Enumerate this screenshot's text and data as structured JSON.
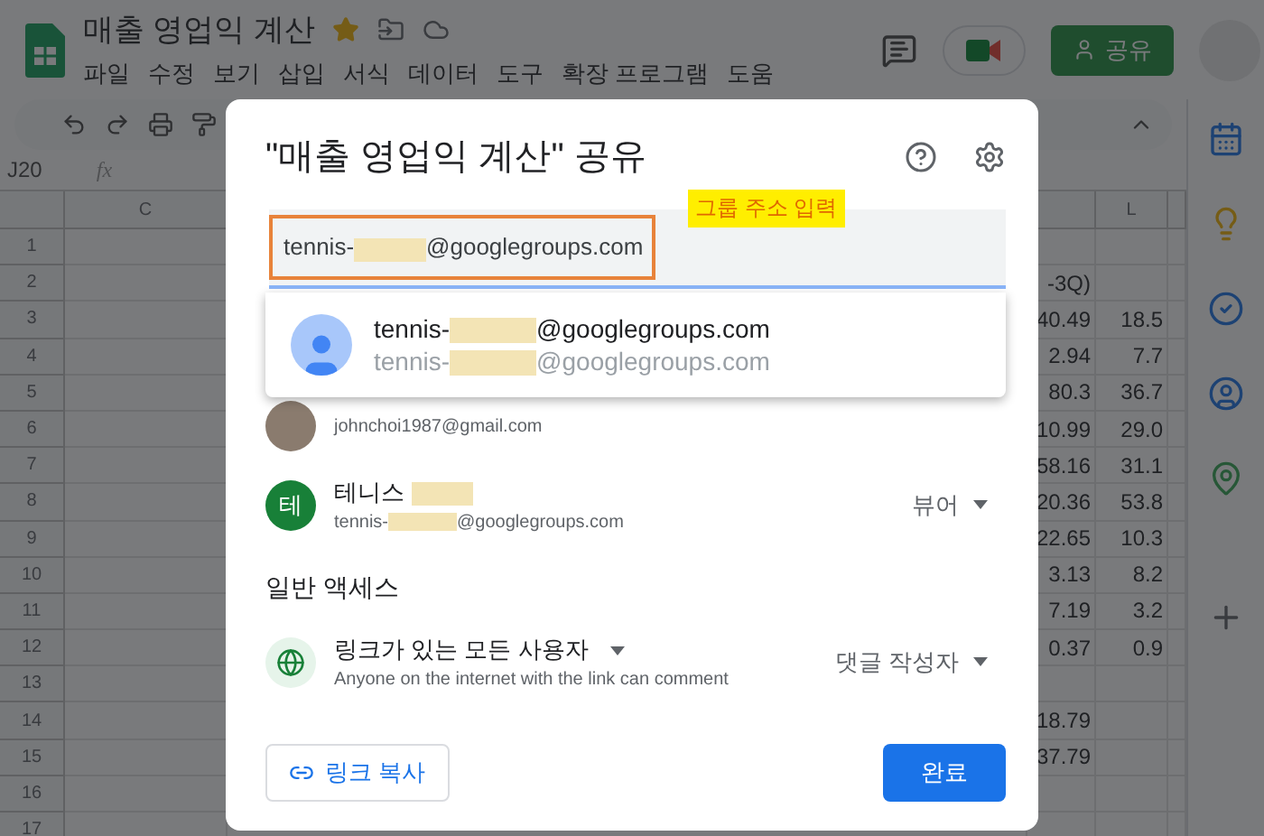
{
  "app": {
    "title": "매출 영업익 계산",
    "menus": [
      "파일",
      "수정",
      "보기",
      "삽입",
      "서식",
      "데이터",
      "도구",
      "확장 프로그램",
      "도움"
    ],
    "share_button": "공유",
    "name_box": "J20",
    "formula_label": "fx"
  },
  "sheet": {
    "columns": [
      "C",
      "L"
    ],
    "rows": [
      {
        "number": "1"
      },
      {
        "number": "2",
        "k": "-3Q)"
      },
      {
        "number": "3",
        "k": "40.49",
        "l": "18.5"
      },
      {
        "number": "4",
        "k": "2.94",
        "l": "7.7"
      },
      {
        "number": "5",
        "k": "80.3",
        "l": "36.7"
      },
      {
        "number": "6",
        "k": "10.99",
        "l": "29.0"
      },
      {
        "number": "7",
        "k": "58.16",
        "l": "31.1"
      },
      {
        "number": "8",
        "k": "20.36",
        "l": "53.8"
      },
      {
        "number": "9",
        "k": "22.65",
        "l": "10.3"
      },
      {
        "number": "10",
        "k": "3.13",
        "l": "8.2"
      },
      {
        "number": "11",
        "k": "7.19",
        "l": "3.2"
      },
      {
        "number": "12",
        "k": "0.37",
        "l": "0.9"
      },
      {
        "number": "13"
      },
      {
        "number": "14",
        "k": "18.79"
      },
      {
        "number": "15",
        "k": "37.79"
      },
      {
        "number": "16"
      },
      {
        "number": "17"
      }
    ]
  },
  "dialog": {
    "title": "\"매출 영업익 계산\" 공유",
    "annotation": "그룹 주소 입력",
    "input": {
      "prefix": "tennis-",
      "suffix": "@googlegroups.com"
    },
    "suggestion": {
      "name_prefix": "tennis-",
      "name_suffix": "@googlegroups.com",
      "email_prefix": "tennis-",
      "email_suffix": "@googlegroups.com"
    },
    "people": [
      {
        "kind": "photo",
        "email": "johnchoi1987@gmail.com"
      },
      {
        "kind": "initial",
        "initial": "테",
        "name": "테니스",
        "email_prefix": "tennis-",
        "email_suffix": "@googlegroups.com",
        "role": "뷰어"
      }
    ],
    "general_access": {
      "heading": "일반 액세스",
      "option": "링크가 있는 모든 사용자",
      "description": "Anyone on the internet with the link can comment",
      "role": "댓글 작성자"
    },
    "copy_link": "링크 복사",
    "done": "완료"
  }
}
